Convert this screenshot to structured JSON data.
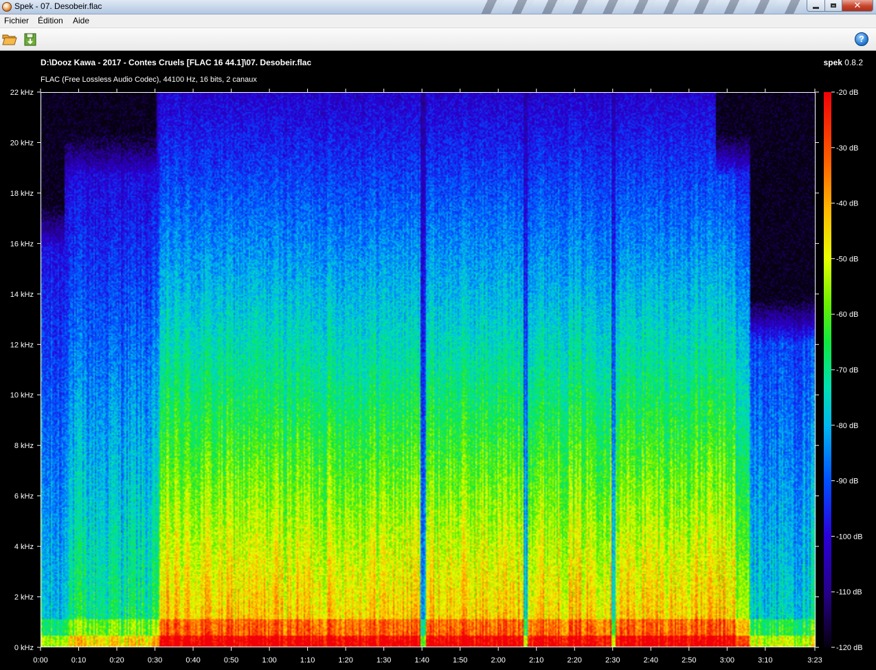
{
  "window": {
    "title": "Spek - 07. Desobeir.flac"
  },
  "menu": {
    "items": [
      "Fichier",
      "Édition",
      "Aide"
    ]
  },
  "toolbar": {
    "open_icon": "folder-open-icon",
    "save_icon": "save-image-icon",
    "help_icon": "help-icon",
    "help_glyph": "?"
  },
  "header": {
    "file_path": "D:\\Dooz Kawa - 2017 - Contes Cruels [FLAC 16 44.1]\\07. Desobeir.flac",
    "brand_name": "spek",
    "brand_version": "0.8.2",
    "codec_info": "FLAC (Free Lossless Audio Codec), 44100 Hz, 16 bits, 2 canaux"
  },
  "chart_data": {
    "type": "heatmap",
    "title": "",
    "xlabel": "",
    "ylabel": "",
    "x_ticks": [
      "0:00",
      "0:10",
      "0:20",
      "0:30",
      "0:40",
      "0:50",
      "1:00",
      "1:10",
      "1:20",
      "1:30",
      "1:40",
      "1:50",
      "2:00",
      "2:10",
      "2:20",
      "2:30",
      "2:40",
      "2:50",
      "3:00",
      "3:10",
      "3:23"
    ],
    "x_tick_seconds": [
      0,
      10,
      20,
      30,
      40,
      50,
      60,
      70,
      80,
      90,
      100,
      110,
      120,
      130,
      140,
      150,
      160,
      170,
      180,
      190,
      203
    ],
    "xlim_seconds": [
      0,
      203
    ],
    "y_ticks": [
      "0 kHz",
      "2 kHz",
      "4 kHz",
      "6 kHz",
      "8 kHz",
      "10 kHz",
      "12 kHz",
      "14 kHz",
      "16 kHz",
      "18 kHz",
      "20 kHz",
      "22 kHz"
    ],
    "y_tick_khz": [
      0,
      2,
      4,
      6,
      8,
      10,
      12,
      14,
      16,
      18,
      20,
      22
    ],
    "ylim_khz": [
      0,
      22
    ],
    "colorbar_ticks": [
      "-20 dB",
      "-30 dB",
      "-40 dB",
      "-50 dB",
      "-60 dB",
      "-70 dB",
      "-80 dB",
      "-90 dB",
      "-100 dB",
      "-110 dB",
      "-120 dB"
    ],
    "colorbar_db": [
      -20,
      -30,
      -40,
      -50,
      -60,
      -70,
      -80,
      -90,
      -100,
      -110,
      -120
    ],
    "colorbar_range_db": [
      -120,
      -20
    ],
    "colors": {
      "loud": "#f20008",
      "mid": "#10e840",
      "quiet": "#2a00d8",
      "silence": "#060010"
    }
  }
}
